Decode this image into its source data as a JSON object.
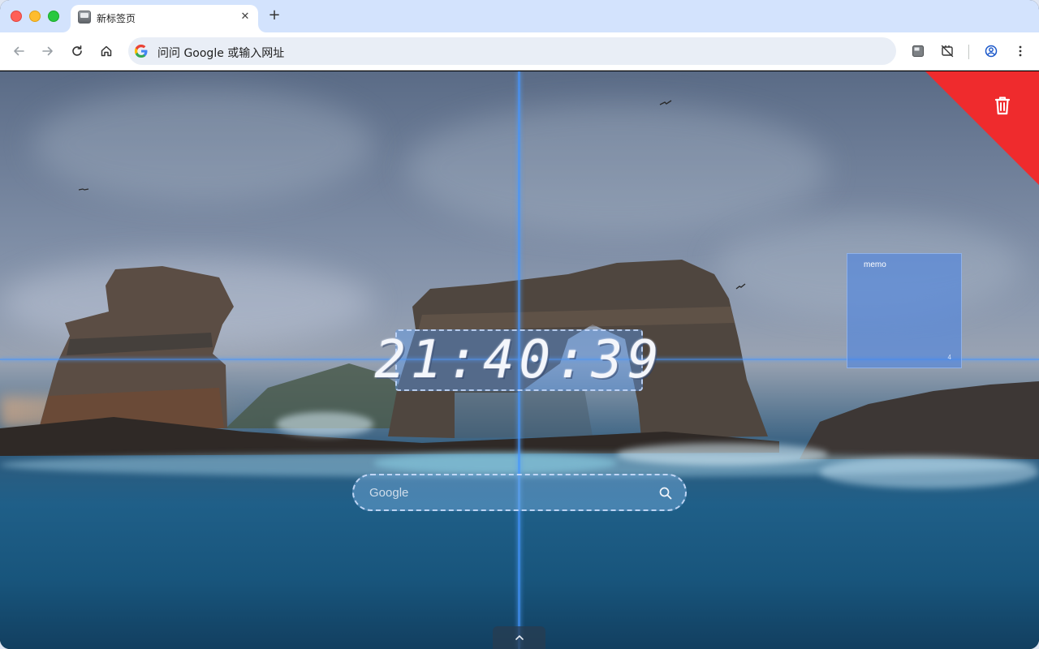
{
  "browser": {
    "tab": {
      "title": "新标签页",
      "close_glyph": "✕"
    },
    "new_tab_glyph": "+",
    "omnibox": {
      "placeholder": "问问 Google 或输入网址"
    },
    "icons": {
      "back": "back-arrow-icon",
      "forward": "forward-arrow-icon",
      "reload": "reload-icon",
      "home": "home-icon",
      "extension_1": "tab-manager-extension-icon",
      "extension_2": "ad-block-extension-icon",
      "profile": "profile-icon",
      "menu": "more-vert-icon"
    }
  },
  "newtab": {
    "clock": {
      "time": "21:40:39"
    },
    "search": {
      "placeholder": "Google"
    },
    "memo": {
      "title": "memo",
      "count": "4"
    },
    "trash": {
      "icon": "trash-icon",
      "color": "#ef2b2d"
    },
    "colors": {
      "crosshair": "#4696ff",
      "widget_fill": "#5a96e6"
    }
  }
}
